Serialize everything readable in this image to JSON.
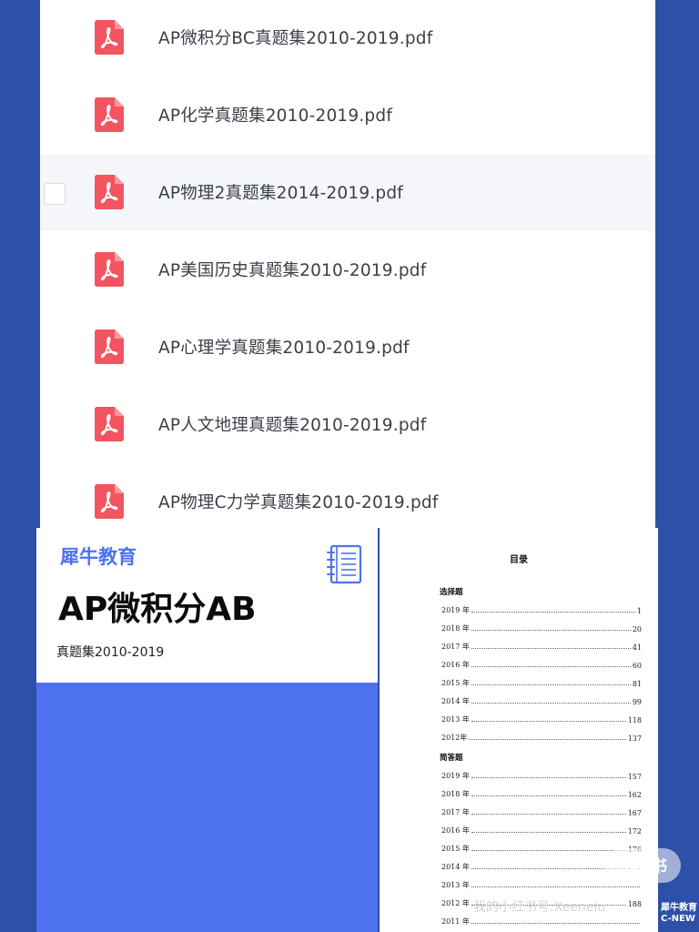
{
  "files": [
    {
      "name": "AP微积分BC真题集2010-2019.pdf",
      "highlighted": false
    },
    {
      "name": "AP化学真题集2010-2019.pdf",
      "highlighted": false
    },
    {
      "name": "AP物理2真题集2014-2019.pdf",
      "highlighted": true
    },
    {
      "name": "AP美国历史真题集2010-2019.pdf",
      "highlighted": false
    },
    {
      "name": "AP心理学真题集2010-2019.pdf",
      "highlighted": false
    },
    {
      "name": "AP人文地理真题集2010-2019.pdf",
      "highlighted": false
    },
    {
      "name": "AP物理C力学真题集2010-2019.pdf",
      "highlighted": false
    }
  ],
  "cover": {
    "brand": "犀牛教育",
    "title": "AP微积分AB",
    "subtitle": "真题集2010-2019",
    "icon": "notebook-icon"
  },
  "toc": {
    "title": "目录",
    "sections": [
      {
        "name": "选择题",
        "entries": [
          {
            "label": "2019 年",
            "page": "1"
          },
          {
            "label": "2018 年",
            "page": "20"
          },
          {
            "label": "2017 年",
            "page": "41"
          },
          {
            "label": "2016 年",
            "page": "60"
          },
          {
            "label": "2015 年",
            "page": "81"
          },
          {
            "label": "2014 年",
            "page": "99"
          },
          {
            "label": "2013 年",
            "page": "118"
          },
          {
            "label": "2012年",
            "page": "137"
          }
        ]
      },
      {
        "name": "简答题",
        "entries": [
          {
            "label": "2019 年",
            "page": "157"
          },
          {
            "label": "2018 年",
            "page": "162"
          },
          {
            "label": "2017 年",
            "page": "167"
          },
          {
            "label": "2016 年",
            "page": "172"
          },
          {
            "label": "2015 年",
            "page": "176"
          },
          {
            "label": "2014 年",
            "page": ""
          },
          {
            "label": "2013 年",
            "page": ""
          },
          {
            "label": "2012 年",
            "page": "188"
          },
          {
            "label": "2011 年",
            "page": ""
          }
        ]
      }
    ]
  },
  "watermark": {
    "badge": "小红书",
    "id_text": "我的小红书号:Xeeneiu",
    "corner_line1": "犀牛教育",
    "corner_line2": "C-NEW"
  },
  "colors": {
    "background": "#2f50a8",
    "accent": "#4e72ef",
    "pdf_icon": "#f2555f"
  }
}
